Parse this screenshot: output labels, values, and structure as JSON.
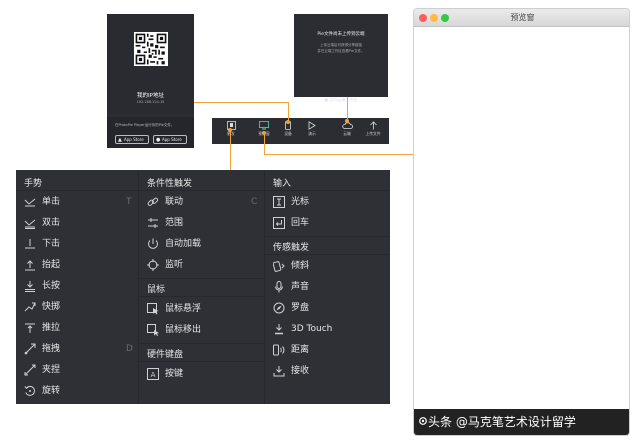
{
  "qr_popup": {
    "title": "我的IP地址",
    "ip": "192.168.124.15",
    "description": "在ProtoPie Player运行你的Pie文件。",
    "android_button": "App Store",
    "ios_button": "App Store"
  },
  "cloud_popup": {
    "line1": "Pie文件尚未上传到云端",
    "line2": "上传云端后可获得分享链接",
    "line3": "并在云端工作区查看Pie文件。",
    "button": "访问云端工作区"
  },
  "toolbar": {
    "items": [
      {
        "label": "触发",
        "icon": "trigger-icon"
      },
      {
        "label": "预览窗",
        "icon": "preview-monitor-icon"
      },
      {
        "label": "设备",
        "icon": "device-phone-icon"
      },
      {
        "label": "演示",
        "icon": "play-icon"
      },
      {
        "label": "云端",
        "icon": "cloud-icon"
      },
      {
        "label": "上传文件",
        "icon": "upload-icon"
      }
    ]
  },
  "triggers": {
    "gesture": {
      "title": "手势",
      "items": [
        {
          "label": "单击",
          "icon": "tap-icon",
          "key": "T"
        },
        {
          "label": "双击",
          "icon": "double-tap-icon",
          "key": ""
        },
        {
          "label": "下击",
          "icon": "touch-down-icon",
          "key": ""
        },
        {
          "label": "抬起",
          "icon": "touch-up-icon",
          "key": ""
        },
        {
          "label": "长按",
          "icon": "long-press-icon",
          "key": ""
        },
        {
          "label": "快掷",
          "icon": "fling-icon",
          "key": ""
        },
        {
          "label": "推拉",
          "icon": "pull-icon",
          "key": ""
        },
        {
          "label": "拖拽",
          "icon": "drag-icon",
          "key": "D"
        },
        {
          "label": "夹捏",
          "icon": "pinch-icon",
          "key": ""
        },
        {
          "label": "旋转",
          "icon": "rotate-icon",
          "key": ""
        }
      ]
    },
    "conditional": {
      "title": "条件性触发",
      "items": [
        {
          "label": "联动",
          "icon": "chain-link-icon",
          "key": "C"
        },
        {
          "label": "范围",
          "icon": "range-icon",
          "key": ""
        },
        {
          "label": "自动加载",
          "icon": "auto-load-icon",
          "key": ""
        },
        {
          "label": "监听",
          "icon": "listen-target-icon",
          "key": ""
        }
      ]
    },
    "mouse": {
      "title": "鼠标",
      "items": [
        {
          "label": "鼠标悬浮",
          "icon": "hover-icon"
        },
        {
          "label": "鼠标移出",
          "icon": "mouse-out-icon"
        }
      ]
    },
    "keyboard": {
      "title": "硬件键盘",
      "items": [
        {
          "label": "按键",
          "icon": "key-a-icon"
        }
      ]
    },
    "input": {
      "title": "输入",
      "items": [
        {
          "label": "光标",
          "icon": "cursor-icon"
        },
        {
          "label": "回车",
          "icon": "return-icon"
        }
      ]
    },
    "sensor": {
      "title": "传感触发",
      "items": [
        {
          "label": "倾斜",
          "icon": "tilt-icon"
        },
        {
          "label": "声音",
          "icon": "microphone-icon"
        },
        {
          "label": "罗盘",
          "icon": "compass-icon"
        },
        {
          "label": "3D Touch",
          "icon": "3d-touch-icon"
        },
        {
          "label": "距离",
          "icon": "proximity-icon"
        },
        {
          "label": "接收",
          "icon": "receive-icon"
        }
      ]
    }
  },
  "preview_window": {
    "title": "预览窗"
  },
  "watermark": "头条 @马克笔艺术设计留学",
  "colors": {
    "panel_bg": "#2e3036",
    "accent": "#f3a33c",
    "text": "#e6e6e6"
  }
}
